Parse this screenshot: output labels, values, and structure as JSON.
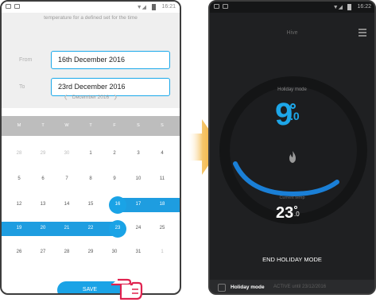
{
  "left_screen": {
    "status_time": "16:21",
    "header_text": "temperature for a defined set for the time",
    "from_label": "From",
    "to_label": "To",
    "from_value": "16th December 2016",
    "to_value": "23rd December 2016",
    "month_nav": {
      "prev": "❮",
      "label": "December 2016",
      "next": "❯"
    },
    "weekdays": [
      "M",
      "T",
      "W",
      "T",
      "F",
      "S",
      "S"
    ],
    "weeks": [
      [
        "28",
        "29",
        "30",
        "1",
        "2",
        "3",
        "4"
      ],
      [
        "5",
        "6",
        "7",
        "8",
        "9",
        "10",
        "11"
      ],
      [
        "12",
        "13",
        "14",
        "15",
        "16",
        "17",
        "18"
      ],
      [
        "19",
        "20",
        "21",
        "22",
        "23",
        "24",
        "25"
      ],
      [
        "26",
        "27",
        "28",
        "29",
        "30",
        "31",
        "1"
      ]
    ],
    "selected_start": "16",
    "selected_end": "23",
    "save_label": "SAVE"
  },
  "right_screen": {
    "status_time": "16:22",
    "title": "Hive",
    "mode_label": "Holiday mode",
    "target_temp_whole": "9",
    "target_temp_decimal": ".0",
    "current_label": "Current temp",
    "current_temp_whole": "23",
    "current_temp_decimal": ".0",
    "end_button": "END HOLIDAY MODE",
    "bottom_label": "Holiday mode",
    "bottom_sub": "ACTIVE until 23/12/2016"
  },
  "colors": {
    "accent_blue": "#1aa3e6",
    "dark_bg": "#1f2022",
    "arrow_orange": "#f0a623"
  },
  "icons": {
    "hand": "pointing-hand-icon",
    "arrow": "right-arrow-icon",
    "flame": "flame-icon",
    "menu": "hamburger-menu-icon"
  }
}
